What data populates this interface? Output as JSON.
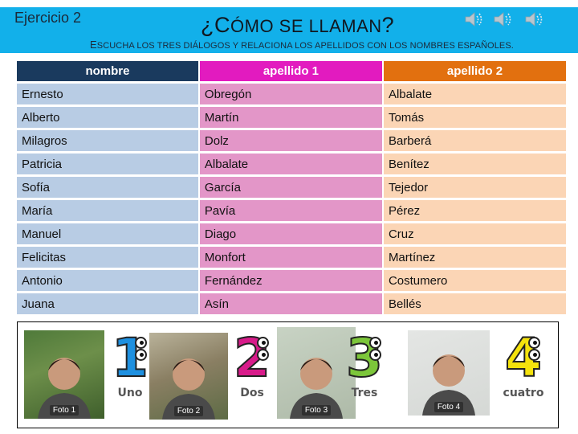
{
  "header": {
    "exercise_label": "Ejercicio 2",
    "title_prefix": "¿C",
    "title_sc1": "ÓMO SE LLAMAN",
    "title_suffix": "?",
    "instructions_first": "E",
    "instructions_rest": "SCUCHA LOS TRES DIÁLOGOS Y RELACIONA LOS APELLIDOS CON LOS NOMBRES ESPAÑOLES.",
    "background_color": "#12b0ea",
    "audio_buttons": [
      {
        "icon": "speaker-icon",
        "label": "Audio 1"
      },
      {
        "icon": "speaker-icon",
        "label": "Audio 2"
      },
      {
        "icon": "speaker-icon",
        "label": "Audio 3"
      }
    ]
  },
  "table": {
    "headers": [
      "nombre",
      "apellido 1",
      "apellido 2"
    ],
    "header_colors": [
      "#1a3a5e",
      "#e21bbf",
      "#e2700f"
    ],
    "cell_colors": [
      "#b8cce4",
      "#e396c8",
      "#fbd5b5"
    ],
    "rows": [
      [
        "Ernesto",
        "Obregón",
        "Albalate"
      ],
      [
        "Alberto",
        "Martín",
        "Tomás"
      ],
      [
        "Milagros",
        "Dolz",
        "Barberá"
      ],
      [
        "Patricia",
        "Albalate",
        "Benítez"
      ],
      [
        "Sofía",
        "García",
        "Tejedor"
      ],
      [
        "María",
        "Pavía",
        "Pérez"
      ],
      [
        "Manuel",
        "Diago",
        "Cruz"
      ],
      [
        "Felicitas",
        "Monfort",
        "Martínez"
      ],
      [
        "Antonio",
        "Fernández",
        "Costumero"
      ],
      [
        "Juana",
        "Asín",
        "Bellés"
      ]
    ]
  },
  "pictures": {
    "items": [
      {
        "type": "photo",
        "label": "Foto 1"
      },
      {
        "type": "number",
        "digit": "1",
        "word": "Uno",
        "color": "#1e90e0"
      },
      {
        "type": "photo",
        "label": "Foto 2"
      },
      {
        "type": "number",
        "digit": "2",
        "word": "Dos",
        "color": "#d81b8a"
      },
      {
        "type": "photo",
        "label": "Foto 3"
      },
      {
        "type": "number",
        "digit": "3",
        "word": "Tres",
        "color": "#7cc63a"
      },
      {
        "type": "photo",
        "label": "Foto 4"
      },
      {
        "type": "number",
        "digit": "4",
        "word": "cuatro",
        "color": "#f4e20c"
      }
    ]
  }
}
